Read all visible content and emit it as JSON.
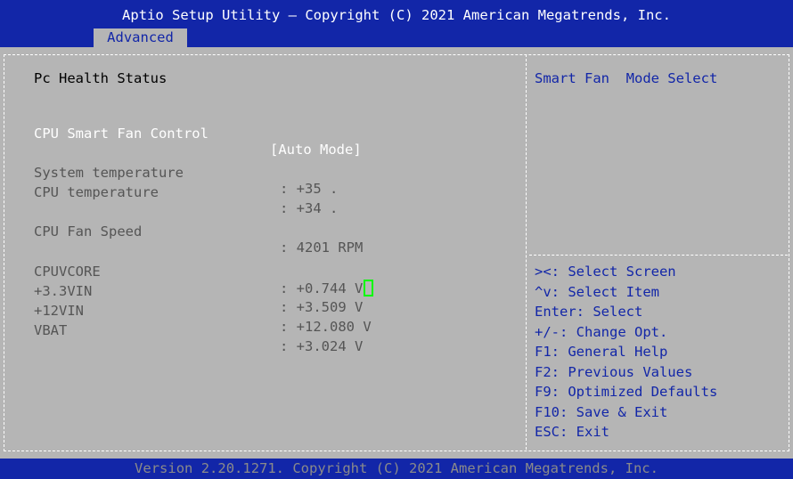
{
  "header": {
    "title": "Aptio Setup Utility – Copyright (C) 2021 American Megatrends, Inc.",
    "active_tab": "Advanced"
  },
  "left_panel": {
    "section_title": "Pc Health Status",
    "fan_control": {
      "label": "CPU Smart Fan Control",
      "value": "[Auto Mode]"
    },
    "readings": [
      {
        "label": "System temperature",
        "value": ": +35 ."
      },
      {
        "label": "CPU temperature",
        "value": ": +34 ."
      },
      {
        "label": "CPU Fan Speed",
        "value": ": 4201 RPM"
      },
      {
        "label": "CPUVCORE",
        "value": ": +0.744 V"
      },
      {
        "label": "+3.3VIN",
        "value": ": +3.509 V"
      },
      {
        "label": "+12VIN",
        "value": ": +12.080 V"
      },
      {
        "label": "VBAT",
        "value": ": +3.024 V"
      }
    ]
  },
  "help_panel": {
    "item_help": "Smart Fan  Mode Select",
    "keys": [
      "><: Select Screen",
      "^v: Select Item",
      "Enter: Select",
      "+/-: Change Opt.",
      "F1: General Help",
      "F2: Previous Values",
      "F9: Optimized Defaults",
      "F10: Save & Exit",
      "ESC: Exit"
    ]
  },
  "footer": {
    "text": "Version 2.20.1271. Copyright (C) 2021 American Megatrends, Inc."
  },
  "colors": {
    "bar_blue": "#1226a8",
    "panel_gray": "#b5b5b5",
    "highlight_white": "#ffffff",
    "cursor_green": "#00ff00"
  }
}
